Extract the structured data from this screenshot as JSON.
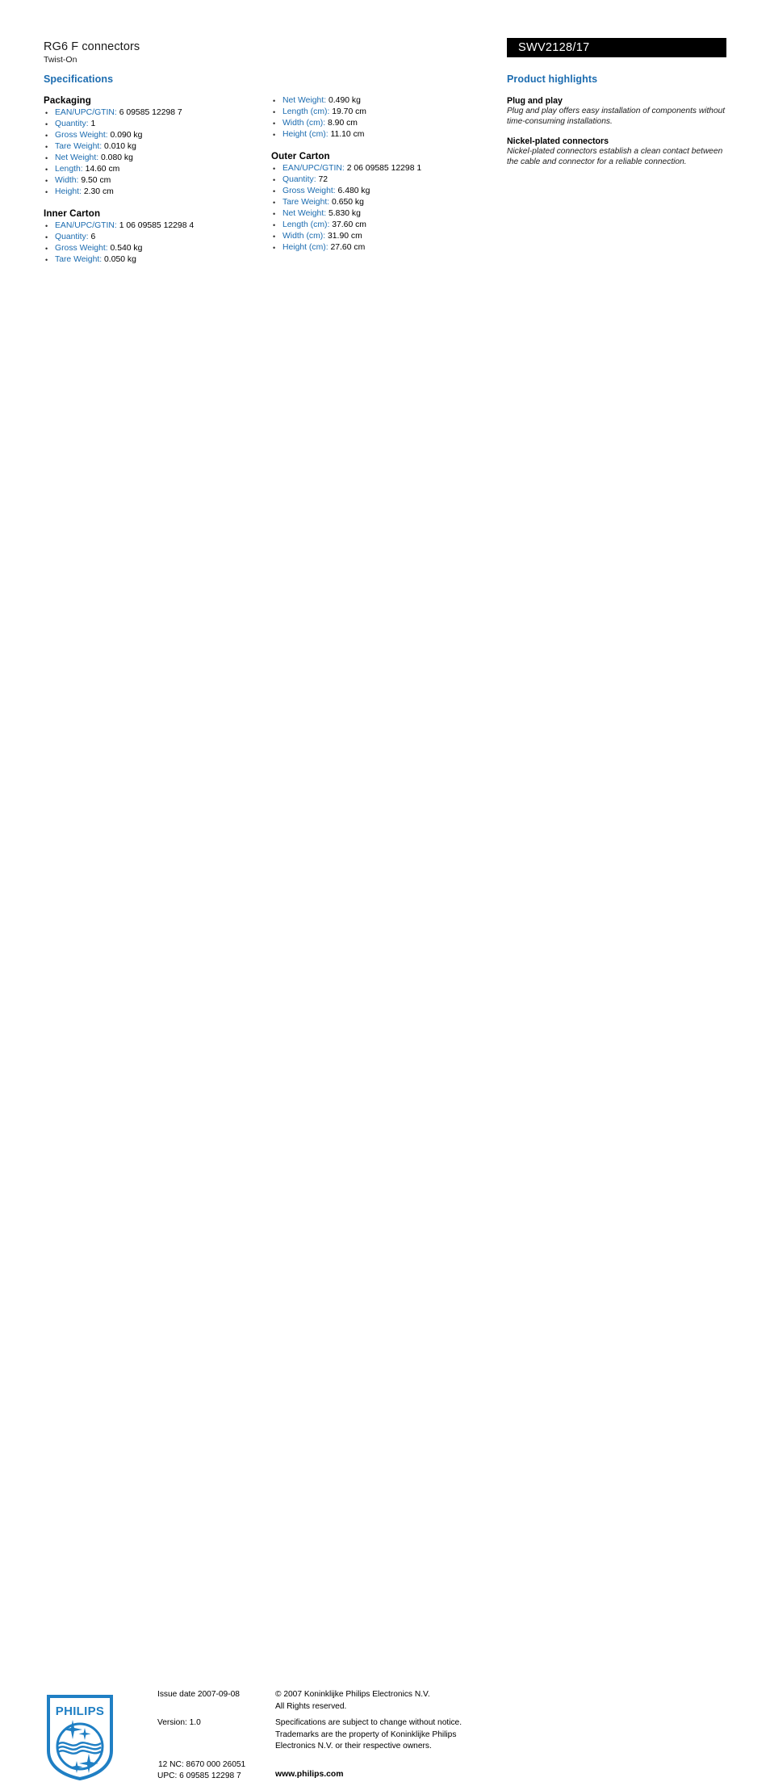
{
  "header": {
    "title": "RG6 F connectors",
    "subtitle": "Twist-On",
    "model": "SWV2128/17"
  },
  "specifications": {
    "heading": "Specifications",
    "groups": [
      {
        "id": "packaging",
        "column": "left",
        "title": "Packaging",
        "items": [
          {
            "label": "EAN/UPC/GTIN:",
            "value": "6 09585 12298 7"
          },
          {
            "label": "Quantity:",
            "value": "1"
          },
          {
            "label": "Gross Weight:",
            "value": "0.090 kg"
          },
          {
            "label": "Tare Weight:",
            "value": "0.010 kg"
          },
          {
            "label": "Net Weight:",
            "value": "0.080 kg"
          },
          {
            "label": "Length:",
            "value": "14.60 cm"
          },
          {
            "label": "Width:",
            "value": "9.50 cm"
          },
          {
            "label": "Height:",
            "value": "2.30 cm"
          }
        ]
      },
      {
        "id": "inner-carton",
        "column": "left",
        "title": "Inner Carton",
        "items": [
          {
            "label": "EAN/UPC/GTIN:",
            "value": "1 06 09585 12298 4"
          },
          {
            "label": "Quantity:",
            "value": "6"
          },
          {
            "label": "Gross Weight:",
            "value": "0.540 kg"
          },
          {
            "label": "Tare Weight:",
            "value": "0.050 kg"
          }
        ]
      },
      {
        "id": "inner-carton-continued",
        "column": "mid",
        "title": "",
        "items": [
          {
            "label": "Net Weight:",
            "value": "0.490 kg"
          },
          {
            "label": "Length (cm):",
            "value": "19.70 cm"
          },
          {
            "label": "Width (cm):",
            "value": "8.90 cm"
          },
          {
            "label": "Height (cm):",
            "value": "11.10 cm"
          }
        ]
      },
      {
        "id": "outer-carton",
        "column": "mid",
        "title": "Outer Carton",
        "items": [
          {
            "label": "EAN/UPC/GTIN:",
            "value": "2 06 09585 12298 1"
          },
          {
            "label": "Quantity:",
            "value": "72"
          },
          {
            "label": "Gross Weight:",
            "value": "6.480 kg"
          },
          {
            "label": "Tare Weight:",
            "value": "0.650 kg"
          },
          {
            "label": "Net Weight:",
            "value": "5.830 kg"
          },
          {
            "label": "Length (cm):",
            "value": "37.60 cm"
          },
          {
            "label": "Width (cm):",
            "value": "31.90 cm"
          },
          {
            "label": "Height (cm):",
            "value": "27.60 cm"
          }
        ]
      }
    ]
  },
  "highlights": {
    "heading": "Product highlights",
    "items": [
      {
        "title": "Plug and play",
        "body": "Plug and play offers easy installation of components without time-consuming installations."
      },
      {
        "title": "Nickel-plated connectors",
        "body": "Nickel-plated connectors establish a clean contact between the cable and connector for a reliable connection."
      }
    ]
  },
  "footer": {
    "logo_wordmark": "PHILIPS",
    "issue_date": "Issue date 2007-09-08",
    "version": "Version: 1.0",
    "nc_code": "12 NC: 8670 000 26051",
    "upc_code": "UPC: 6 09585 12298 7",
    "copyright_line1": "© 2007 Koninklijke Philips Electronics N.V.",
    "copyright_line2": "All Rights reserved.",
    "disclaimer": "Specifications are subject to change without notice. Trademarks are the property of Koninklijke Philips Electronics N.V. or their respective owners.",
    "website": "www.philips.com"
  },
  "colors": {
    "accent_blue": "#1c6cb0",
    "logo_blue": "#1f7fc4",
    "bar_black": "#000000",
    "text_black": "#000000",
    "page_background": "#ffffff"
  }
}
